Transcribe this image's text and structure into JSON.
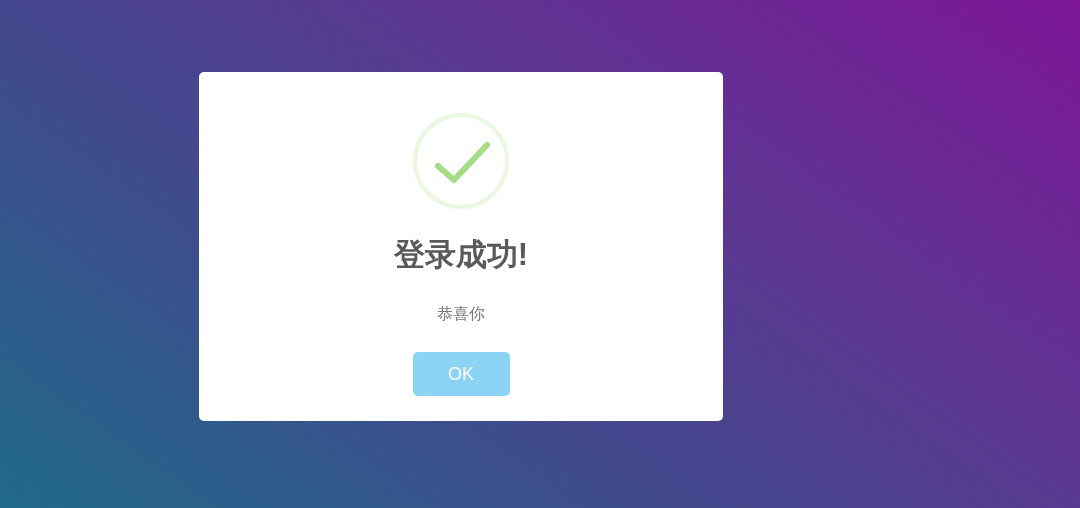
{
  "dialog": {
    "kind": "success",
    "title": "登录成功!",
    "message": "恭喜你",
    "buttons": [
      {
        "label": "OK"
      }
    ]
  }
}
